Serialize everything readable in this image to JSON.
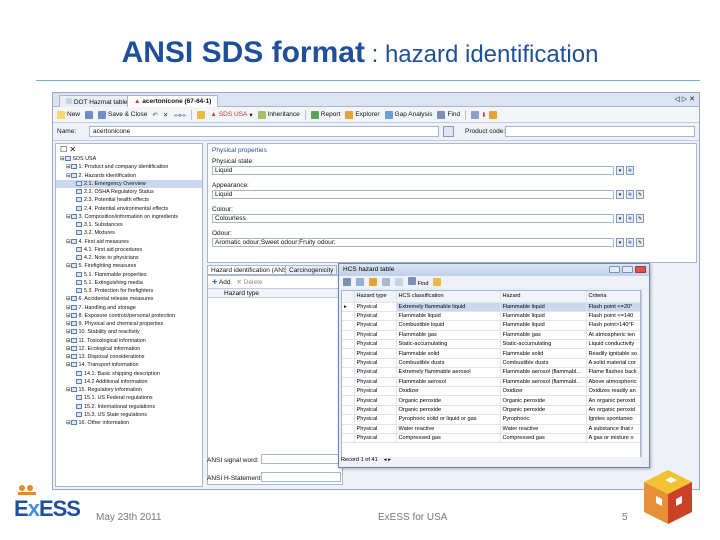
{
  "slide": {
    "title_bold": "ANSI SDS format",
    "title_rest": " : hazard identification",
    "footer_date": "May 23th 2011",
    "footer_center": "ExESS for USA",
    "page_number": "5",
    "logo_text_e": "E",
    "logo_text_x": "x",
    "logo_text_ess": "ESS"
  },
  "app": {
    "tabs": [
      {
        "label": "DOT Hazmat table"
      },
      {
        "label": "acertonicone (67-64-1)"
      }
    ],
    "tab_nav": "◁ ▷ ✕",
    "toolbar": {
      "new": "New",
      "save_close": "Save & Close",
      "sds_usa": "SDS USA",
      "inheritance": "Inheritance",
      "report": "Report",
      "explorer": "Explorer",
      "gap_analysis": "Gap Analysis",
      "find": "Find"
    },
    "name_label": "Name:",
    "name_value": "acertonicone",
    "product_code_label": "Product code:",
    "product_code_value": ""
  },
  "tree": {
    "root": "SDS USA",
    "items": [
      {
        "label": "1. Product and company identification",
        "level": 1
      },
      {
        "label": "2. Hazards identification",
        "level": 1
      },
      {
        "label": "2.1. Emergency Overview",
        "level": 2,
        "selected": true
      },
      {
        "label": "2.2. OSHA Regulatory Status",
        "level": 2
      },
      {
        "label": "2.3. Potential health effects",
        "level": 2
      },
      {
        "label": "2.4. Potential environmental effects",
        "level": 2
      },
      {
        "label": "3. Composition/information on ingredients",
        "level": 1
      },
      {
        "label": "3.1. Substances",
        "level": 2
      },
      {
        "label": "3.2. Mixtures",
        "level": 2
      },
      {
        "label": "4. First aid measures",
        "level": 1
      },
      {
        "label": "4.1. First aid procedures",
        "level": 2
      },
      {
        "label": "4.2. Note to physicians",
        "level": 2
      },
      {
        "label": "5. Firefighting measures",
        "level": 1
      },
      {
        "label": "5.1. Flammable properties",
        "level": 2
      },
      {
        "label": "5.1. Extinguishing media",
        "level": 2
      },
      {
        "label": "5.3. Protection for firefighters",
        "level": 2
      },
      {
        "label": "6. Accidental release measures",
        "level": 1
      },
      {
        "label": "7. Handling and storage",
        "level": 1
      },
      {
        "label": "8. Exposure controls/personal protection",
        "level": 1
      },
      {
        "label": "9. Physical and chemical properties",
        "level": 1
      },
      {
        "label": "10. Stability and reactivity",
        "level": 1
      },
      {
        "label": "11. Toxicological information",
        "level": 1
      },
      {
        "label": "12. Ecological information",
        "level": 1
      },
      {
        "label": "13. Disposal considerations",
        "level": 1
      },
      {
        "label": "14. Transport information",
        "level": 1
      },
      {
        "label": "14.1. Basic shipping description",
        "level": 2
      },
      {
        "label": "14.2 Additional information",
        "level": 2
      },
      {
        "label": "15. Regulatory information",
        "level": 1
      },
      {
        "label": "15.1. US Federal regulations",
        "level": 2
      },
      {
        "label": "15.2. International regulations",
        "level": 2
      },
      {
        "label": "15.3. US State regulations",
        "level": 2
      },
      {
        "label": "16. Other information",
        "level": 1
      }
    ]
  },
  "props": {
    "section": "Physical properties",
    "physical_state_label": "Physical state:",
    "physical_state_value": "Liquid",
    "appearance_label": "Appearance:",
    "appearance_value": "Liquid",
    "colour_label": "Colour:",
    "colour_value": "Colourless",
    "odour_label": "Odour:",
    "odour_value": "Aromatic odour;Sweet odour;Fruity odour;"
  },
  "subtabs": [
    {
      "label": "Hazard identification (ANSI)"
    },
    {
      "label": "Carcinogenicity"
    }
  ],
  "subpanel": {
    "add": "Add",
    "delete": "Delete",
    "col_hazard_type": "Hazard type",
    "signal_word_label": "ANSI signal word:",
    "h_statements_label": "ANSI H-Statements:"
  },
  "hcs": {
    "title": "HCS hazard table",
    "find": "Find",
    "columns": [
      "Hazard type",
      "HCS classification",
      "Hazard",
      "Criteria"
    ],
    "rows": [
      [
        "Physical",
        "Extremely flammable liquid",
        "Flammable liquid",
        "Flash point <=20°"
      ],
      [
        "Physical",
        "Flammable liquid",
        "Flammable liquid",
        "Flash point <=140"
      ],
      [
        "Physical",
        "Combustible liquid",
        "Flammable liquid",
        "Flash point>140°F"
      ],
      [
        "Physical",
        "Flammable gas",
        "Flammable gas",
        "At atmospheric ten"
      ],
      [
        "Physical",
        "Static-accumulating",
        "Static-accumulating",
        "Liquid conductivity"
      ],
      [
        "Physical",
        "Flammable solid",
        "Flammable solid",
        "Readily ignitable so"
      ],
      [
        "Physical",
        "Combustible dusts",
        "Combustible dusts",
        "A solid material cor"
      ],
      [
        "Physical",
        "Extremely flammable aerosol",
        "Flammable aerosol (flammabl...",
        "Flame flashes back"
      ],
      [
        "Physical",
        "Flammable aerosol",
        "Flammable aerosol (flammabl...",
        "Above atmospheric"
      ],
      [
        "Physical",
        "Oxidizer",
        "Oxidizer",
        "Oxidizes readily an"
      ],
      [
        "Physical",
        "Organic peroxide",
        "Organic peroxide",
        "An organic peroxid"
      ],
      [
        "Physical",
        "Organic peroxide",
        "Organic peroxide",
        "An organic peroxid"
      ],
      [
        "Physical",
        "Pyrophoric solid or liquid or gas",
        "Pyrophoric",
        "Ignites spontaneo"
      ],
      [
        "Physical",
        "Water reactive",
        "Water reactive",
        "A substance that r"
      ],
      [
        "Physical",
        "Compressed gas",
        "Compressed gas",
        "A gas or mixture o"
      ]
    ],
    "record_text": "Record 1 of 41"
  }
}
